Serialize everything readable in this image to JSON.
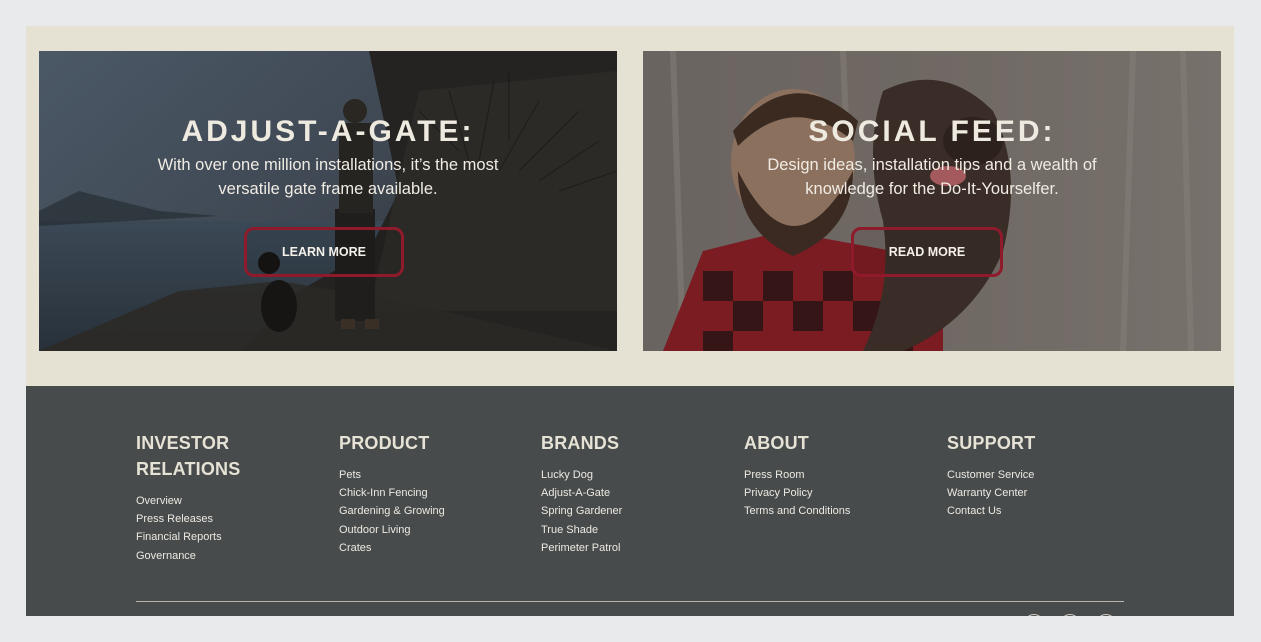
{
  "promo_cards": [
    {
      "title": "ADJUST-A-GATE:",
      "text": "With over one million installations, it’s the most versatile gate frame available.",
      "button": "LEARN MORE",
      "image": "man-with-dog-at-lakeshore"
    },
    {
      "title": "SOCIAL FEED:",
      "text": "Design ideas, installation tips and a wealth of knowledge for the Do-It-Yourselfer.",
      "button": "READ MORE",
      "image": "bearded-man-holding-dog"
    }
  ],
  "footer": {
    "investor": {
      "heading": "INVESTOR RELATIONS",
      "links": [
        "Overview",
        "Press Releases",
        "Financial Reports",
        "Governance"
      ]
    },
    "product": {
      "heading": "PRODUCT",
      "links": [
        "Pets",
        "Chick-Inn Fencing",
        "Gardening & Growing",
        "Outdoor Living",
        "Crates"
      ]
    },
    "brands": {
      "heading": "BRANDS",
      "links": [
        "Lucky Dog",
        "Adjust-A-Gate",
        "Spring Gardener",
        "True Shade",
        "Perimeter Patrol"
      ]
    },
    "about": {
      "heading": "ABOUT",
      "links": [
        "Press Room",
        "Privacy Policy",
        "Terms and Conditions"
      ]
    },
    "support": {
      "heading": "SUPPORT",
      "links": [
        "Customer Service",
        "Warranty Center",
        "Contact Us"
      ]
    }
  },
  "colors": {
    "promo_band": "#e6e2d3",
    "footer_bg": "#484b4c",
    "button_border": "#8e1a2c",
    "heading_text": "#e6e2d6"
  },
  "icons": [
    "social-icon-1",
    "social-icon-2",
    "social-icon-3"
  ]
}
